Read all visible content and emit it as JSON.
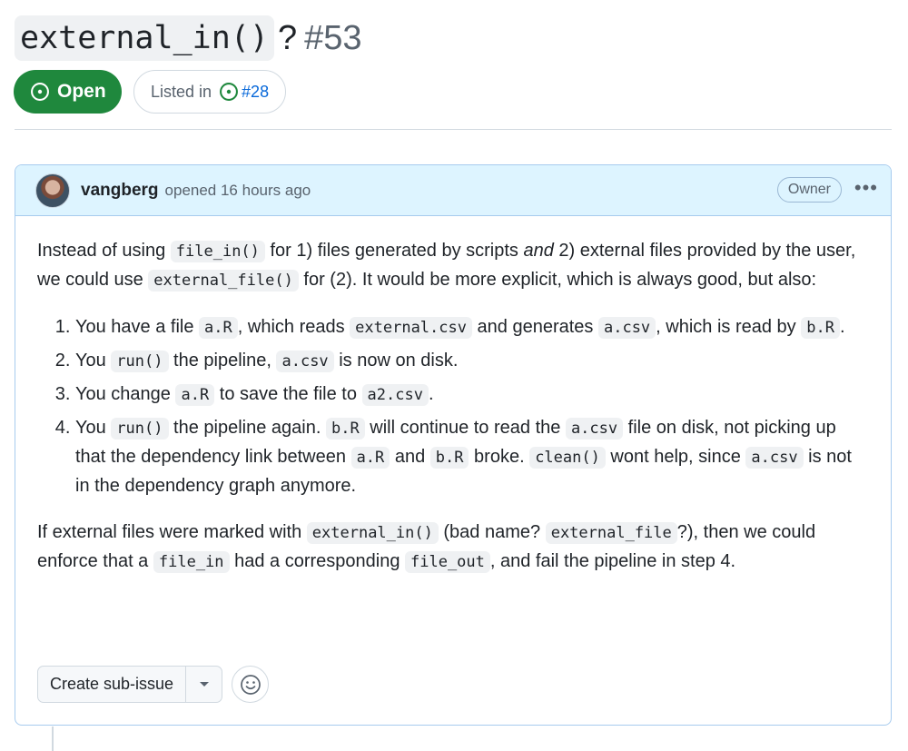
{
  "issue": {
    "title_code": "external_in()",
    "title_suffix": "?",
    "number": "#53",
    "state_label": "Open",
    "listed_prefix": "Listed in",
    "listed_link": "#28"
  },
  "comment": {
    "author": "vangberg",
    "meta": "opened 16 hours ago",
    "role_badge": "Owner",
    "more_label": "•••",
    "p1": {
      "t1": "Instead of using ",
      "c1": "file_in()",
      "t2": " for 1) files generated by scripts ",
      "em": "and",
      "t3": " 2) external files provided by the user, we could use ",
      "c2": "external_file()",
      "t4": " for (2). It would be more explicit, which is always good, but also:"
    },
    "list": [
      {
        "t1": "You have a file ",
        "c1": "a.R",
        "t2": ", which reads ",
        "c2": "external.csv",
        "t3": " and generates ",
        "c3": "a.csv",
        "t4": ", which is read by ",
        "c4": "b.R",
        "t5": "."
      },
      {
        "t1": "You ",
        "c1": "run()",
        "t2": " the pipeline, ",
        "c2": "a.csv",
        "t3": " is now on disk."
      },
      {
        "t1": "You change ",
        "c1": "a.R",
        "t2": " to save the file to ",
        "c2": "a2.csv",
        "t3": "."
      },
      {
        "t1": "You ",
        "c1": "run()",
        "t2": " the pipeline again. ",
        "c2": "b.R",
        "t3": " will continue to read the ",
        "c3": "a.csv",
        "t4": " file on disk, not picking up that the dependency link between ",
        "c4": "a.R",
        "t5": " and ",
        "c5": "b.R",
        "t6": " broke. ",
        "c6": "clean()",
        "t7": " wont help, since ",
        "c7": "a.csv",
        "t8": " is not in the dependency graph anymore."
      }
    ],
    "p2": {
      "t1": "If external files were marked with ",
      "c1": "external_in()",
      "t2": " (bad name? ",
      "c2": "external_file",
      "t3": "?), then we could enforce that a ",
      "c3": "file_in",
      "t4": " had a corresponding ",
      "c4": "file_out",
      "t5": ", and fail the pipeline in step 4."
    },
    "create_subissue_label": "Create sub-issue"
  },
  "colors": {
    "open_green": "#1f883d",
    "link_blue": "#0969da",
    "header_bg": "#ddf4ff"
  },
  "icons": {
    "state": "issue-opened-icon",
    "listed": "issue-opened-icon",
    "caret": "triangle-down-icon",
    "reaction": "smiley-icon"
  }
}
